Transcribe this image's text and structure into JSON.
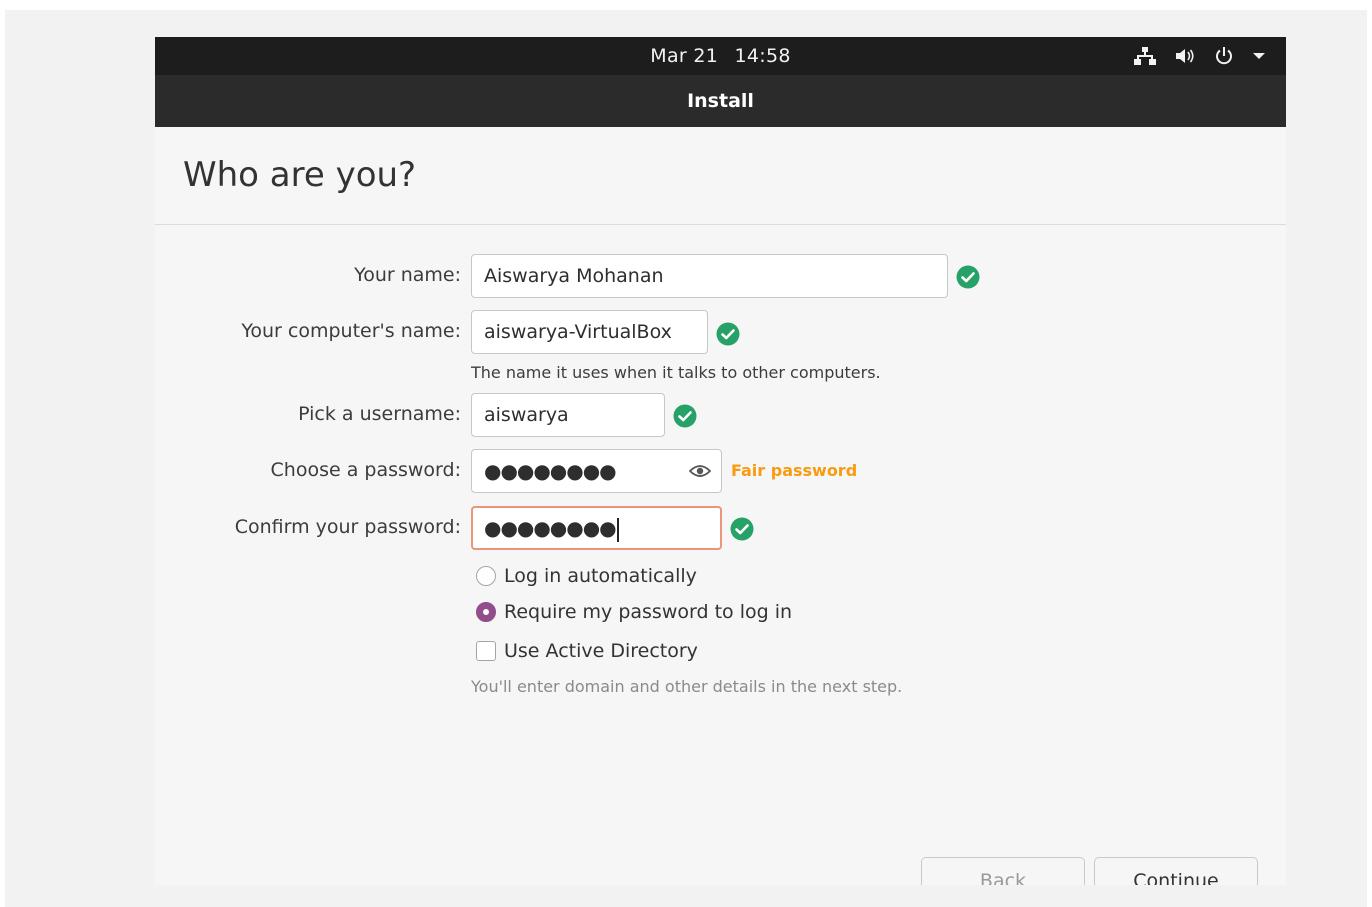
{
  "topbar": {
    "date": "Mar 21",
    "time": "14:58",
    "icons": [
      "network-icon",
      "volume-icon",
      "power-icon",
      "caret-down-icon"
    ]
  },
  "window": {
    "title": "Install"
  },
  "page": {
    "heading": "Who are you?"
  },
  "form": {
    "name_label": "Your name:",
    "name_value": "Aiswarya Mohanan",
    "computer_label": "Your computer's name:",
    "computer_value": "aiswarya-VirtualBox",
    "computer_hint": "The name it uses when it talks to other computers.",
    "username_label": "Pick a username:",
    "username_value": "aiswarya",
    "password_label": "Choose a password:",
    "password_value": "●●●●●●●●",
    "password_strength": "Fair password",
    "confirm_label": "Confirm your password:",
    "confirm_value": "●●●●●●●●"
  },
  "options": {
    "auto_login": "Log in automatically",
    "require_password": "Require my password to log in",
    "active_directory": "Use Active Directory",
    "ad_hint": "You'll enter domain and other details in the next step."
  },
  "buttons": {
    "back": "Back",
    "continue": "Continue"
  },
  "colors": {
    "accent_radio": "#924d8b",
    "ok_green": "#26a269",
    "strength_orange": "#f99b11",
    "focus_border": "#e9967a"
  }
}
